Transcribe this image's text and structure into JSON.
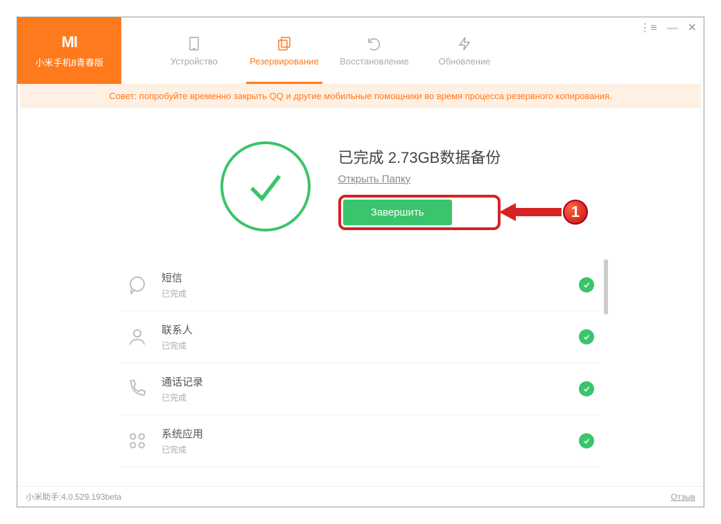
{
  "brand": {
    "logo_text": "MI",
    "device_name": "小米手机8青春版"
  },
  "tabs": {
    "device": "Устройство",
    "backup": "Резервирование",
    "restore": "Восстановление",
    "update": "Обновление"
  },
  "tip": "Совет: попробуйте временно закрыть QQ и другие мобильные помощники во время процесса резервного копирования.",
  "status": {
    "title": "已完成 2.73GB数据备份",
    "open_folder": "Открыть Папку",
    "finish_label": "Завершить"
  },
  "annotation": {
    "callout_number": "1"
  },
  "items": [
    {
      "icon": "message",
      "title": "短信",
      "sub": "已完成"
    },
    {
      "icon": "person",
      "title": "联系人",
      "sub": "已完成"
    },
    {
      "icon": "phone",
      "title": "通话记录",
      "sub": "已完成"
    },
    {
      "icon": "apps",
      "title": "系统应用",
      "sub": "已完成"
    }
  ],
  "footer": {
    "version": "小米助手:4.0.529.193beta",
    "feedback": "Отзыв"
  }
}
